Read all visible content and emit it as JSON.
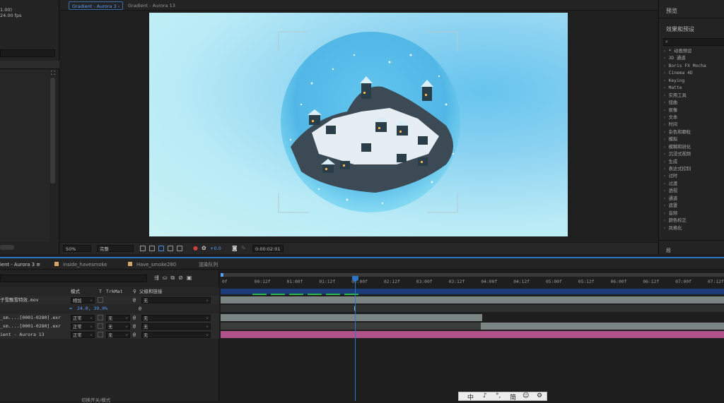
{
  "project": {
    "info_line1": "1.00)",
    "info_line2": "24.00 fps"
  },
  "viewer": {
    "tabs": [
      "Gradient - Aurora 3",
      "Gradient - Aurora 13"
    ],
    "zoom": "50%",
    "resolution": "完整",
    "exposure": "+0.0",
    "timecode": "0:00:02:01"
  },
  "right_panel": {
    "preview_label": "预览",
    "effects_label": "效果和预设",
    "effects": [
      "* 动画预设",
      "3D 通道",
      "Boris FX Mocha",
      "Cinema 4D",
      "Keying",
      "Matte",
      "实用工具",
      "扭曲",
      "抠像",
      "文本",
      "时间",
      "杂色和颗粒",
      "模拟",
      "模糊和锐化",
      "沉浸式视频",
      "生成",
      "表达式控制",
      "过时",
      "过渡",
      "透视",
      "通道",
      "遮罩",
      "音频",
      "颜色校正",
      "风格化"
    ],
    "bottom_label": "段"
  },
  "timeline": {
    "tabs": [
      {
        "label": "ient - Aurora 3",
        "menu": "≡",
        "active": true
      },
      {
        "label": "inside_havesmoke",
        "color": "#d8a96b"
      },
      {
        "label": "Have_smoke280",
        "color": "#d8a96b"
      },
      {
        "label": "渲染队列"
      }
    ],
    "columns": {
      "mode": "模式",
      "t": "T",
      "trkmat": "TrkMat",
      "parent": "父级和链接"
    },
    "layers": [
      {
        "name": "子雪飘雪特效.mov",
        "mode": "相加",
        "trkmat": "",
        "parent": "无",
        "color": "#555555"
      },
      {
        "name": "",
        "sub": "24.0, 39.0%",
        "mode": "",
        "trkmat": "",
        "parent": ""
      },
      {
        "name": "_sm....[0001-0280].exr",
        "mode": "正常",
        "trkmat": "无",
        "parent": "无"
      },
      {
        "name": "_sm....[0001-0280].exr",
        "mode": "正常",
        "trkmat": "无",
        "parent": "无"
      },
      {
        "name": "ient - Aurora 13",
        "mode": "正常",
        "trkmat": "无",
        "parent": "无"
      }
    ],
    "ruler": [
      "0f",
      "00:12f",
      "01:00f",
      "01:12f",
      "02:00f",
      "02:12f",
      "03:00f",
      "03:12f",
      "04:00f",
      "04:12f",
      "05:00f",
      "05:12f",
      "06:00f",
      "06:12f",
      "07:00f",
      "07:12f"
    ],
    "current_time_label": "0:00:02:01",
    "footer": "切换开关/模式"
  },
  "ime": {
    "chars": [
      "中",
      "♪",
      "°,",
      "简",
      "☺",
      "⚙"
    ]
  },
  "colors": {
    "accent": "#2d75c6",
    "layer_pink": "#b0528a",
    "layer_gray": "#7b8684"
  }
}
